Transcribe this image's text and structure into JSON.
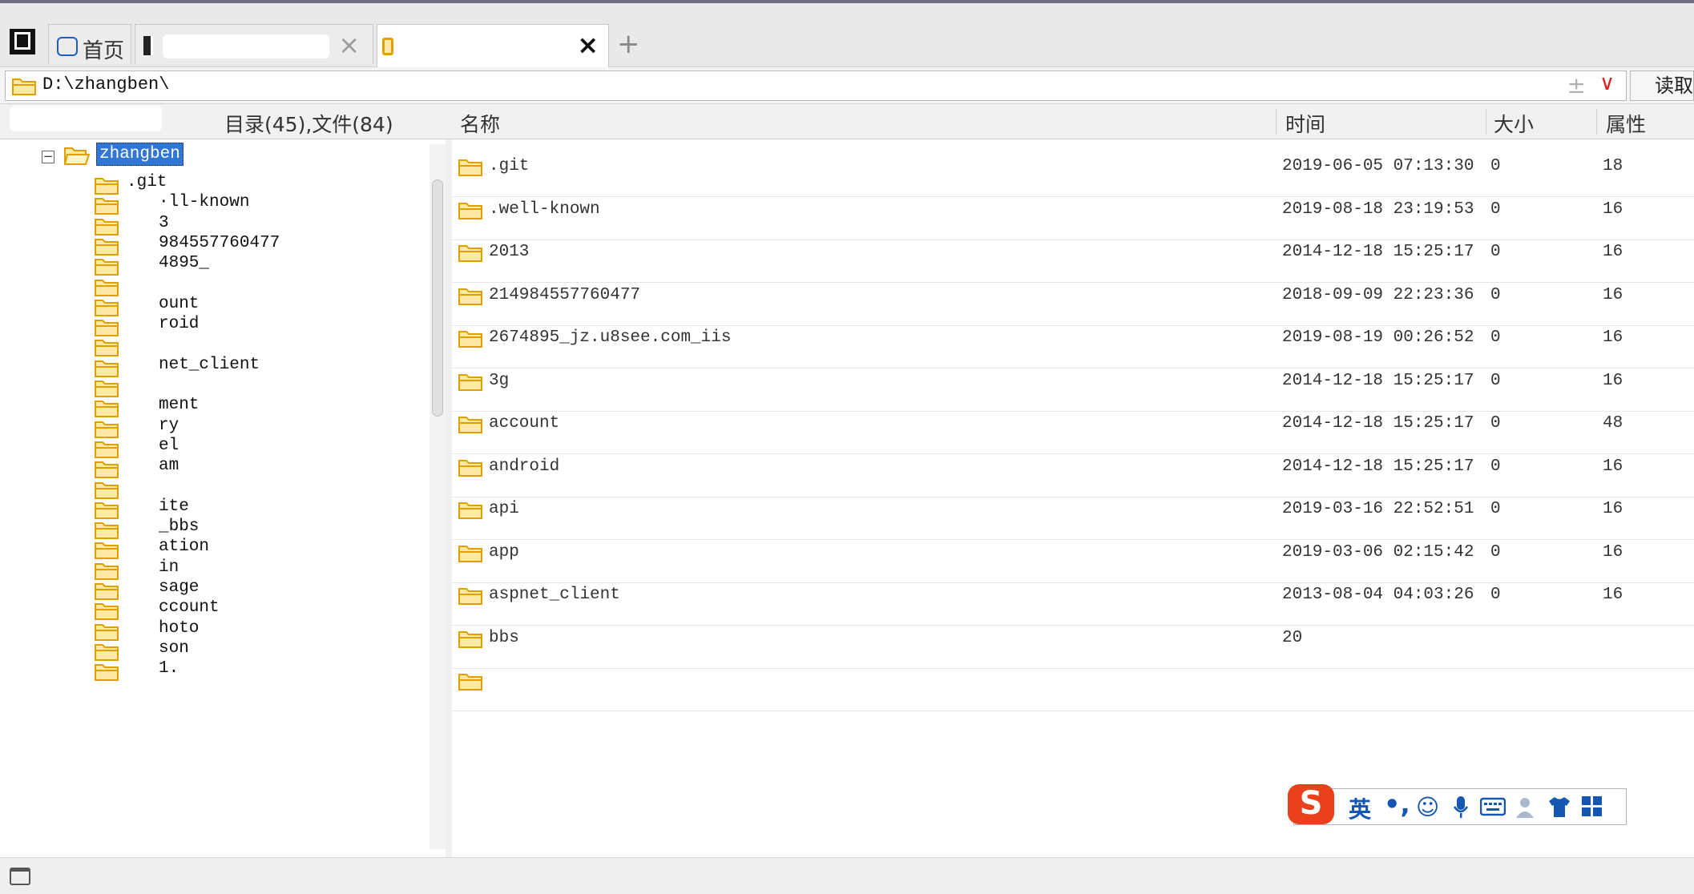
{
  "tabs": {
    "home_label": "首页",
    "tab1_title": "",
    "tab2_title": "",
    "close_glyph": "×",
    "add_glyph": "+"
  },
  "address": {
    "path": "D:\\zhangben\\",
    "pin_glyph": "±",
    "dropdown_glyph": "∨",
    "read_label": "读取"
  },
  "header": {
    "tree_search_placeholder": "",
    "dir_count": "目录(45),文件(84)",
    "col_name": "名称",
    "col_time": "时间",
    "col_size": "大小",
    "col_attr": "属性"
  },
  "tree": {
    "root_label": "zhangben",
    "expander_glyph": "−",
    "items": [
      ".git",
      "·ll-known",
      "3",
      "984557760477",
      "4895_",
      "",
      "ount",
      "roid",
      "",
      "net_client",
      "",
      "ment",
      "ry",
      "el",
      "am",
      "",
      "ite",
      "_bbs",
      "ation",
      "in",
      "sage",
      "ccount",
      "hoto",
      "son",
      "1."
    ]
  },
  "files": [
    {
      "name": ".git",
      "time": "2019-06-05 07:13:30",
      "size": "0",
      "attr": "18"
    },
    {
      "name": ".well-known",
      "time": "2019-08-18 23:19:53",
      "size": "0",
      "attr": "16"
    },
    {
      "name": "2013",
      "time": "2014-12-18 15:25:17",
      "size": "0",
      "attr": "16"
    },
    {
      "name": "214984557760477",
      "time": "2018-09-09 22:23:36",
      "size": "0",
      "attr": "16"
    },
    {
      "name": "2674895_jz.u8see.com_iis",
      "time": "2019-08-19 00:26:52",
      "size": "0",
      "attr": "16"
    },
    {
      "name": "3g",
      "time": "2014-12-18 15:25:17",
      "size": "0",
      "attr": "16"
    },
    {
      "name": "account",
      "time": "2014-12-18 15:25:17",
      "size": "0",
      "attr": "48"
    },
    {
      "name": "android",
      "time": "2014-12-18 15:25:17",
      "size": "0",
      "attr": "16"
    },
    {
      "name": "api",
      "time": "2019-03-16 22:52:51",
      "size": "0",
      "attr": "16"
    },
    {
      "name": "app",
      "time": "2019-03-06 02:15:42",
      "size": "0",
      "attr": "16"
    },
    {
      "name": "aspnet_client",
      "time": "2013-08-04 04:03:26",
      "size": "0",
      "attr": "16"
    },
    {
      "name": "bbs",
      "time": "20",
      "size": "",
      "attr": ""
    },
    {
      "name": "",
      "time": "",
      "size": "",
      "attr": ""
    }
  ],
  "ime": {
    "logo": "S",
    "lang": "英",
    "punct": "•,",
    "icons": [
      "smiley-icon",
      "microphone-icon",
      "keyboard-icon",
      "user-icon",
      "skin-shirt-icon",
      "grid-menu-icon"
    ]
  },
  "colors": {
    "selection": "#3377d6",
    "folder_fill": "#ffe9a5",
    "folder_stroke": "#e0a000",
    "ime_blue": "#1557b0",
    "ime_logo": "#e8411b",
    "dropdown_red": "#dd2222"
  }
}
